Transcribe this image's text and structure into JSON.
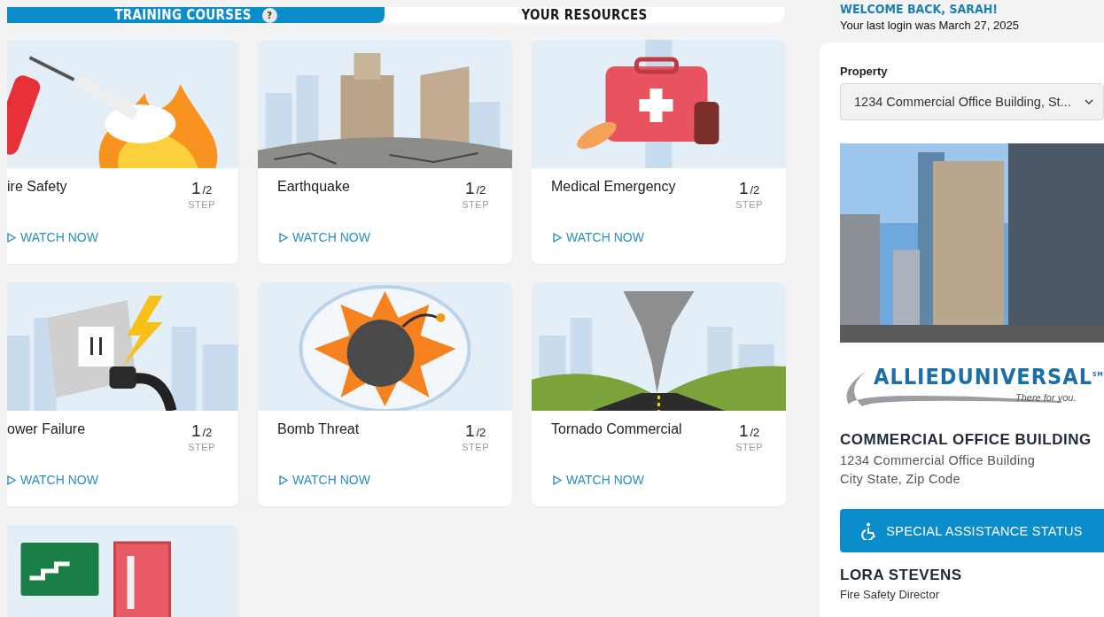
{
  "tabs": [
    {
      "label": "TRAINING COURSES",
      "selected": true,
      "badge": "?"
    },
    {
      "label": "YOUR RESOURCES",
      "selected": false
    }
  ],
  "courses": [
    {
      "kind": "fire",
      "title": "ire Safety",
      "step": "1",
      "total": "/2",
      "step_label": "STEP",
      "action": "WATCH NOW"
    },
    {
      "kind": "earthquake",
      "title": "Earthquake",
      "step": "1",
      "total": "/2",
      "step_label": "STEP",
      "action": "WATCH NOW"
    },
    {
      "kind": "medical",
      "title": "Medical Emergency",
      "step": "1",
      "total": "/2",
      "step_label": "STEP",
      "action": "WATCH NOW"
    },
    {
      "kind": "power",
      "title": "ower Failure",
      "step": "1",
      "total": "/2",
      "step_label": "STEP",
      "action": "WATCH NOW"
    },
    {
      "kind": "bomb",
      "title": "Bomb Threat",
      "step": "1",
      "total": "/2",
      "step_label": "STEP",
      "action": "WATCH NOW"
    },
    {
      "kind": "tornado",
      "title": "Tornado Commercial",
      "step": "1",
      "total": "/2",
      "step_label": "STEP",
      "action": "WATCH NOW"
    },
    {
      "kind": "exit"
    }
  ],
  "sidebar": {
    "welcome": "WELCOME BACK, SARAH!",
    "last_login": "Your last login was March 27, 2025",
    "property_label": "Property",
    "property_value": "1234 Commercial Office Building, St...",
    "logo": {
      "name_light": "ALLIED",
      "name_bold": "UNIVERSAL",
      "mark": "SM",
      "tagline": "There for you."
    },
    "building_name": "COMMERCIAL OFFICE BUILDING",
    "address_lines": [
      "1234 Commercial Office Building",
      "City State, Zip Code"
    ],
    "assistance_button": "SPECIAL ASSISTANCE STATUS",
    "contact_name": "LORA STEVENS",
    "contact_role": "Fire Safety Director"
  }
}
